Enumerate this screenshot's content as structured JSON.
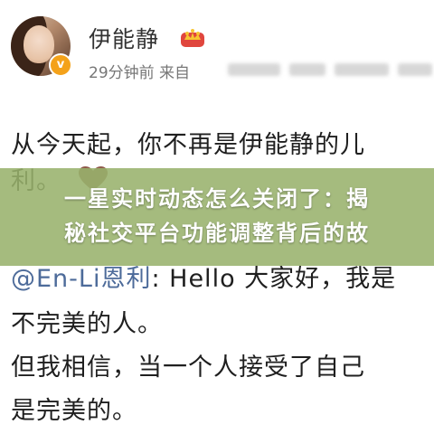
{
  "post": {
    "author_name": "伊能静",
    "time_ago": "29分钟前",
    "source_prefix": "来自",
    "lines": [
      "从今天起，你不再是伊能静的儿",
      "利。",
      "@En-Li恩利",
      ": Hello 大家好，我是",
      "不完美的人。",
      "但我相信，当一个人接受了自己",
      "是完美的。"
    ]
  },
  "overlay": {
    "headline_line1": "一星实时动态怎么关闭了：揭",
    "headline_line2": "秘社交平台功能调整背后的故"
  },
  "icons": {
    "verified": "verified-badge-icon",
    "crown": "crown-icon",
    "heart": "heart-icon"
  },
  "colors": {
    "overlay": "#98b26c",
    "mention": "#4d6b9a",
    "verified": "#f4a21a",
    "crown": "#e0463d"
  }
}
